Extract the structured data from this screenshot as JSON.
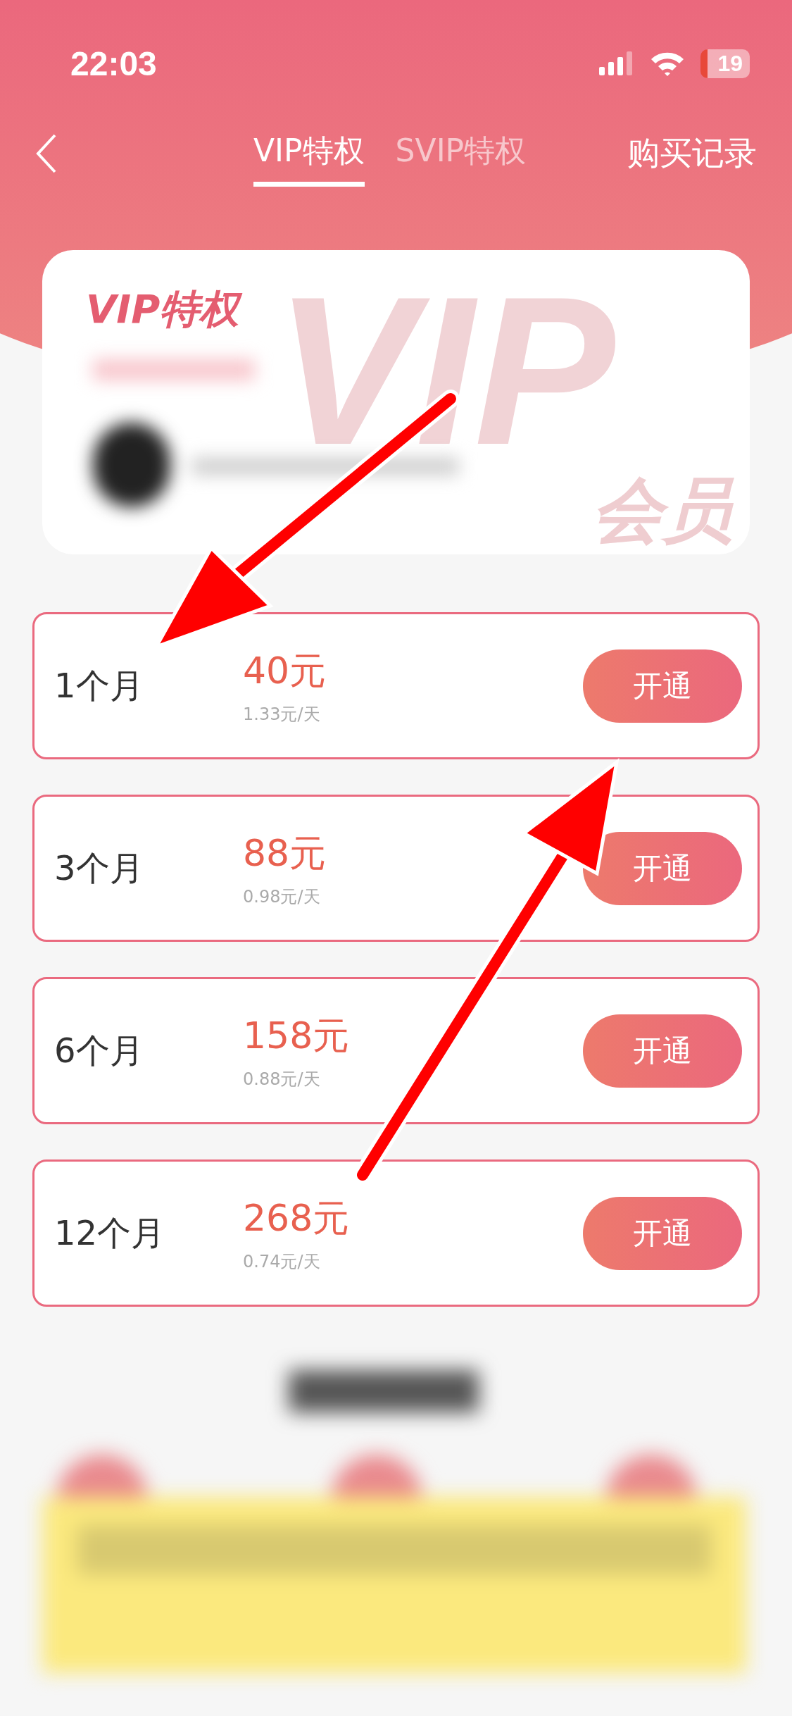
{
  "status_bar": {
    "time": "22:03",
    "battery": "19"
  },
  "tabs": [
    {
      "label": "VIP特权",
      "selected": true
    },
    {
      "label": "SVIP特权",
      "selected": false
    }
  ],
  "purchase_history": "购买记录",
  "privilege_card": {
    "title": "VIP特权",
    "backdrop": "VIP",
    "backdrop_sub": "会员"
  },
  "plans": [
    {
      "duration": "1个月",
      "price": "40元",
      "per_day": "1.33元/天",
      "button": "开通"
    },
    {
      "duration": "3个月",
      "price": "88元",
      "per_day": "0.98元/天",
      "button": "开通"
    },
    {
      "duration": "6个月",
      "price": "158元",
      "per_day": "0.88元/天",
      "button": "开通"
    },
    {
      "duration": "12个月",
      "price": "268元",
      "per_day": "0.74元/天",
      "button": "开通"
    }
  ]
}
